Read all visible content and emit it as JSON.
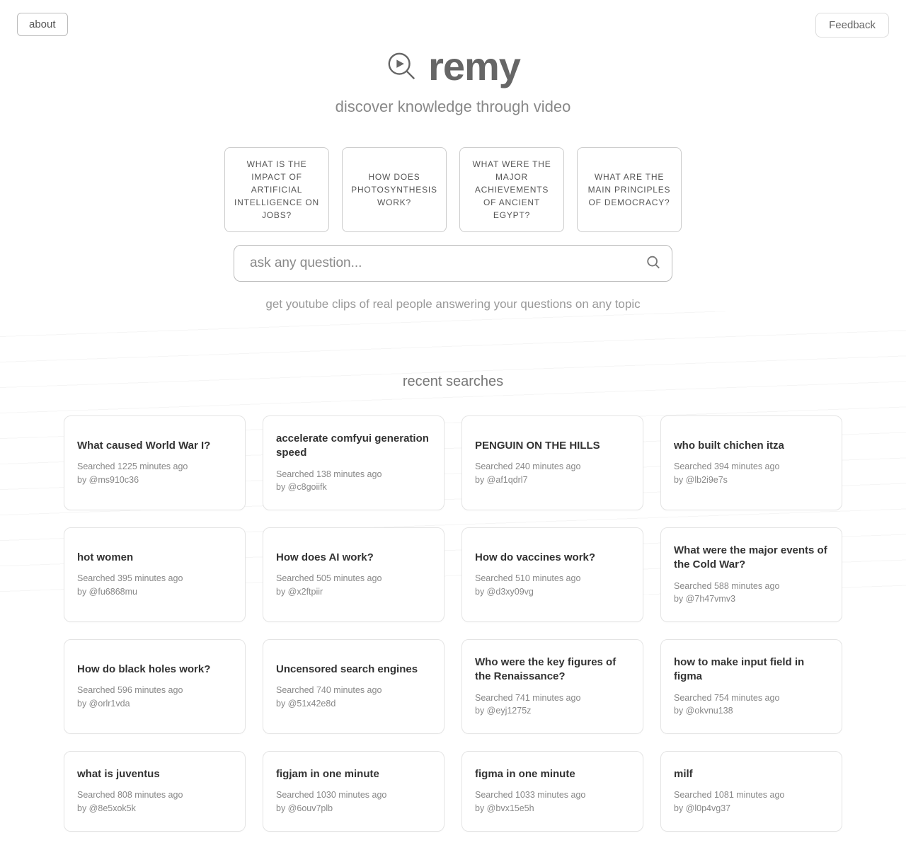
{
  "topbar": {
    "about_label": "about",
    "feedback_label": "Feedback"
  },
  "logo": {
    "text": "remy"
  },
  "tagline": "discover knowledge through video",
  "suggestions": [
    "WHAT IS THE IMPACT OF ARTIFICIAL INTELLIGENCE ON JOBS?",
    "HOW DOES PHOTOSYNTHESIS WORK?",
    "WHAT WERE THE MAJOR ACHIEVEMENTS OF ANCIENT EGYPT?",
    "WHAT ARE THE MAIN PRINCIPLES OF DEMOCRACY?"
  ],
  "search": {
    "placeholder": "ask any question..."
  },
  "subtext": "get youtube clips of real people answering your questions on any topic",
  "recent_header": "recent searches",
  "recent": [
    {
      "title": "What caused World War I?",
      "when": "Searched 1225 minutes ago",
      "by": "by @ms910c36"
    },
    {
      "title": "accelerate comfyui generation speed",
      "when": "Searched 138 minutes ago",
      "by": "by @c8goiifk"
    },
    {
      "title": "PENGUIN ON THE HILLS",
      "when": "Searched 240 minutes ago",
      "by": "by @af1qdrl7"
    },
    {
      "title": "who built chichen itza",
      "when": "Searched 394 minutes ago",
      "by": "by @lb2i9e7s"
    },
    {
      "title": "hot women",
      "when": "Searched 395 minutes ago",
      "by": "by @fu6868mu"
    },
    {
      "title": "How does AI work?",
      "when": "Searched 505 minutes ago",
      "by": "by @x2ftpiir"
    },
    {
      "title": "How do vaccines work?",
      "when": "Searched 510 minutes ago",
      "by": "by @d3xy09vg"
    },
    {
      "title": "What were the major events of the Cold War?",
      "when": "Searched 588 minutes ago",
      "by": "by @7h47vmv3"
    },
    {
      "title": "How do black holes work?",
      "when": "Searched 596 minutes ago",
      "by": "by @orlr1vda"
    },
    {
      "title": "Uncensored search engines",
      "when": "Searched 740 minutes ago",
      "by": "by @51x42e8d"
    },
    {
      "title": "Who were the key figures of the Renaissance?",
      "when": "Searched 741 minutes ago",
      "by": "by @eyj1275z"
    },
    {
      "title": "how to make input field in figma",
      "when": "Searched 754 minutes ago",
      "by": "by @okvnu138"
    },
    {
      "title": "what is juventus",
      "when": "Searched 808 minutes ago",
      "by": "by @8e5xok5k"
    },
    {
      "title": "figjam in one minute",
      "when": "Searched 1030 minutes ago",
      "by": "by @6ouv7plb"
    },
    {
      "title": "figma in one minute",
      "when": "Searched 1033 minutes ago",
      "by": "by @bvx15e5h"
    },
    {
      "title": "milf",
      "when": "Searched 1081 minutes ago",
      "by": "by @l0p4vg37"
    }
  ]
}
